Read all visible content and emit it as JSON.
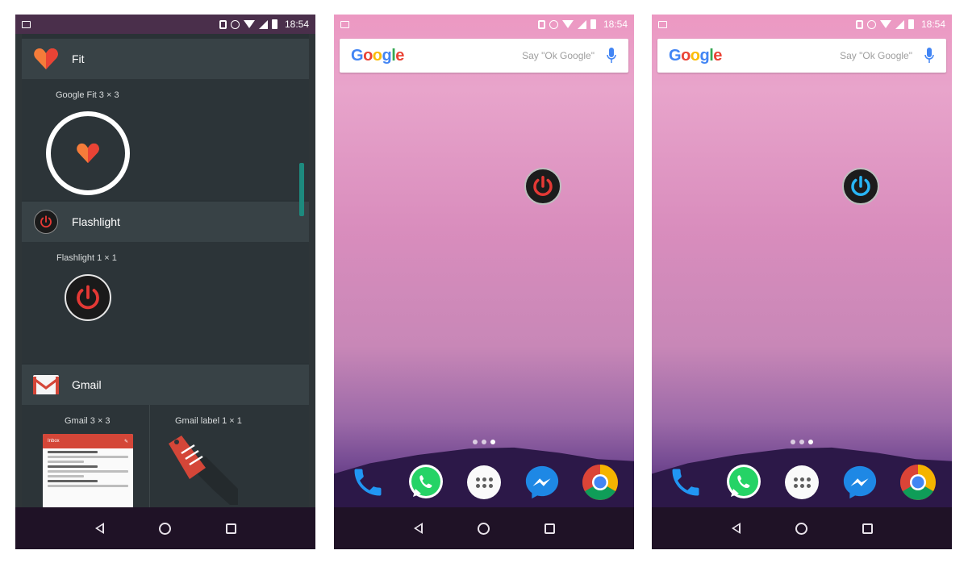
{
  "status_bar": {
    "time": "18:54"
  },
  "widget_picker": {
    "sections": [
      {
        "app": "Fit",
        "widgets": [
          {
            "label": "Google Fit 3 × 3"
          }
        ]
      },
      {
        "app": "Flashlight",
        "widgets": [
          {
            "label": "Flashlight 1 × 1"
          }
        ]
      },
      {
        "app": "Gmail",
        "widgets": [
          {
            "label": "Gmail 3 × 3"
          },
          {
            "label": "Gmail label 1 × 1"
          }
        ]
      }
    ],
    "gmail_preview_header": "Inbox"
  },
  "home_screen": {
    "search": {
      "logo": "Google",
      "hint": "Say \"Ok Google\""
    },
    "flashlight_color_off": "#e53935",
    "flashlight_color_on": "#29b6f6",
    "dock": [
      "phone-icon",
      "whatsapp-icon",
      "app-drawer-icon",
      "messenger-icon",
      "chrome-icon"
    ]
  },
  "colors": {
    "fit_heart_orange": "#f57c3a",
    "gmail_red": "#d44638",
    "teal_scroll": "#1d8a7e"
  }
}
